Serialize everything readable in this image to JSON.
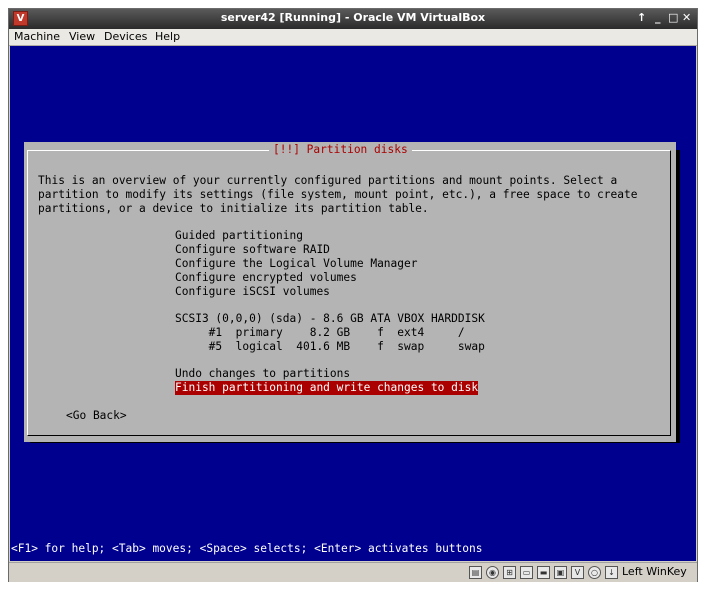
{
  "window": {
    "title": "server42 [Running] - Oracle VM VirtualBox",
    "controls": {
      "pin": "↑",
      "minimize": "_",
      "maximize": "□",
      "close": "✕"
    }
  },
  "menu": [
    "Machine",
    "View",
    "Devices",
    "Help"
  ],
  "dialog": {
    "title": "[!!] Partition disks",
    "description": [
      "This is an overview of your currently configured partitions and mount points. Select a",
      "partition to modify its settings (file system, mount point, etc.), a free space to create",
      "partitions, or a device to initialize its partition table."
    ],
    "options": [
      "Guided partitioning",
      "Configure software RAID",
      "Configure the Logical Volume Manager",
      "Configure encrypted volumes",
      "Configure iSCSI volumes"
    ],
    "disk": {
      "header": "SCSI3 (0,0,0) (sda) - 8.6 GB ATA VBOX HARDDISK",
      "partitions": [
        "     #1  primary    8.2 GB    f  ext4     /",
        "     #5  logical  401.6 MB    f  swap     swap"
      ]
    },
    "actions": [
      "Undo changes to partitions",
      "Finish partitioning and write changes to disk"
    ],
    "go_back": "<Go Back>"
  },
  "help_line": "<F1> for help; <Tab> moves; <Space> selects; <Enter> activates buttons",
  "statusbar": {
    "host_key": "Left WinKey"
  },
  "colors": {
    "screen_bg": "#00008f",
    "dialog_bg": "#b4b4b4",
    "selection_bg": "#aa0000",
    "title_fg": "#aa0000"
  }
}
